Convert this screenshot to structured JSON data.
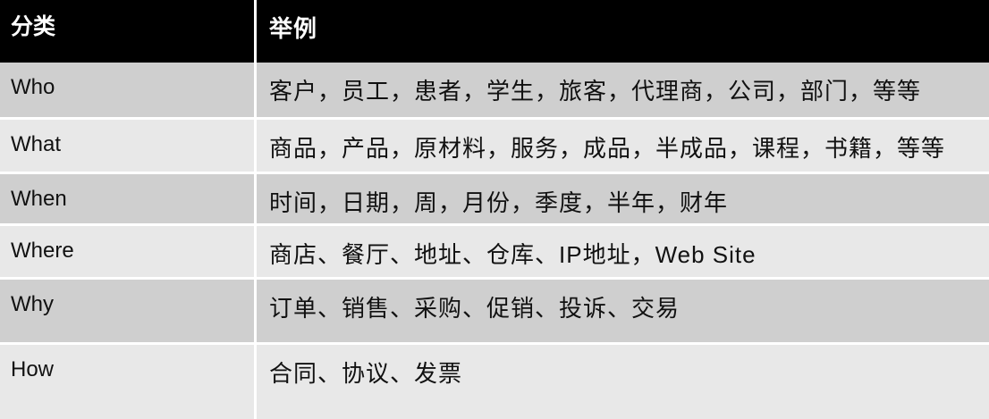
{
  "table": {
    "header": {
      "category": "分类",
      "example": "举例"
    },
    "rows": [
      {
        "category": "Who",
        "example": "客户，员工，患者，学生，旅客，代理商，公司，部门，等等"
      },
      {
        "category": "What",
        "example": "商品，产品，原材料，服务，成品，半成品，课程，书籍，等等"
      },
      {
        "category": "When",
        "example": "时间，日期，周，月份，季度，半年，财年"
      },
      {
        "category": "Where",
        "example": "商店、餐厅、地址、仓库、IP地址，Web Site"
      },
      {
        "category": "Why",
        "example": "订单、销售、采购、促销、投诉、交易"
      },
      {
        "category": "How",
        "example": "合同、协议、发票"
      }
    ],
    "colors": {
      "header_bg": "#000000",
      "row_dark": "#cfcfcf",
      "row_light": "#e8e8e8"
    }
  }
}
